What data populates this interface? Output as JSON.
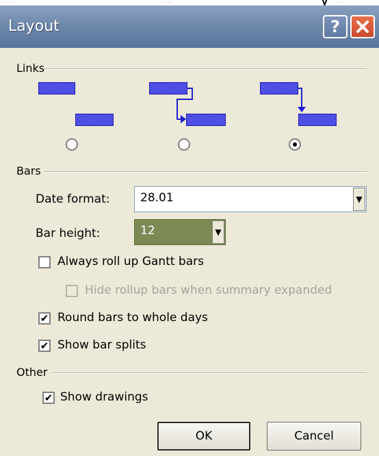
{
  "dialog": {
    "title": "Layout",
    "help_icon": "help-icon",
    "close_icon": "close-icon"
  },
  "links": {
    "legend": "Links",
    "options": [
      {
        "style": "no-line",
        "selected": false
      },
      {
        "style": "end-to-start-elbow",
        "selected": false
      },
      {
        "style": "end-to-top",
        "selected": true
      }
    ],
    "colors": {
      "bar": "#3e3ee2",
      "line": "#1f1fd0"
    }
  },
  "bars": {
    "legend": "Bars",
    "date_format_label": "Date format:",
    "date_format_value": "28.01",
    "bar_height_label": "Bar height:",
    "bar_height_value": "12",
    "bar_height_bg": "#7b8a55",
    "always_roll_up_label": "Always roll up Gantt bars",
    "always_roll_up_checked": false,
    "hide_rollup_label": "Hide rollup bars when summary expanded",
    "hide_rollup_checked": false,
    "hide_rollup_enabled": false,
    "round_bars_label": "Round bars to whole days",
    "round_bars_checked": true,
    "show_splits_label": "Show bar splits",
    "show_splits_checked": true
  },
  "other": {
    "legend": "Other",
    "show_drawings_label": "Show drawings",
    "show_drawings_checked": true
  },
  "buttons": {
    "ok": "OK",
    "cancel": "Cancel"
  },
  "checkmark": "✔",
  "dropdown_arrow": "▼"
}
